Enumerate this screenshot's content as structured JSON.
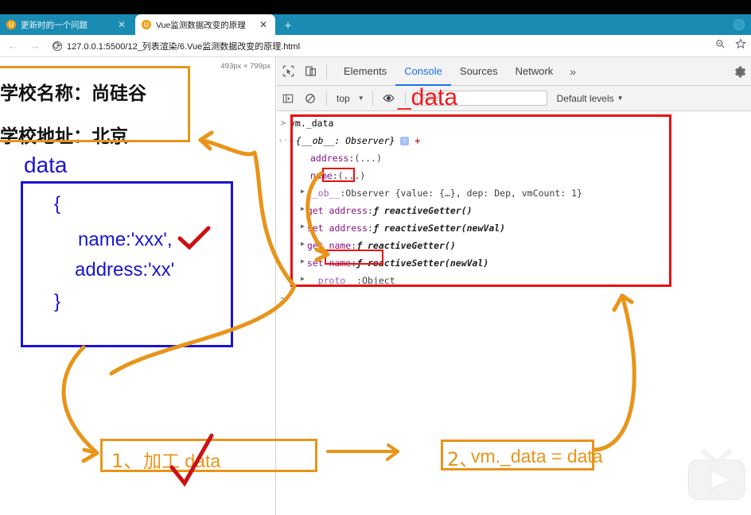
{
  "browser": {
    "tabs": [
      {
        "title": "更新时的一个问题",
        "active": false,
        "close": "✕"
      },
      {
        "title": "Vue监测数据改变的原理",
        "active": true,
        "close": "✕"
      }
    ],
    "new_tab_label": "+",
    "back_label": "←",
    "forward_label": "→",
    "reload_label": "⟳",
    "info_label": "i",
    "url": "127.0.0.1:5500/12_列表渲染/6.Vue监测数据改变的原理.html",
    "zoom_icon_label": "search-zoom",
    "bookmark_icon_label": "star",
    "tabbar_color": "#1a8bb3"
  },
  "page": {
    "viewport_size": "493px × 799px",
    "lines": [
      "学校名称：尚硅谷",
      "学校地址：北京"
    ]
  },
  "devtools": {
    "inspect_icon": "cursor-select-icon",
    "device_icon": "device-toolbar-icon",
    "tabs": [
      {
        "label": "Elements",
        "active": false
      },
      {
        "label": "Console",
        "active": true
      },
      {
        "label": "Sources",
        "active": false
      },
      {
        "label": "Network",
        "active": false
      }
    ],
    "more_tabs": "»",
    "settings_icon": "gear-icon",
    "console_toolbar": {
      "sidebar_toggle": "console-sidebar-icon",
      "clear_label": "clear-console-icon",
      "context": "top",
      "context_caret": "▼",
      "eye_icon": "live-expression-eye-icon",
      "filter_placeholder": "Filter",
      "levels": "Default levels",
      "levels_caret": "▼"
    },
    "console": {
      "input_prompt": ">",
      "input_expression": "vm._data",
      "result_prompt": "‹·",
      "result_header": {
        "triangle": "▼",
        "text": "{__ob__: Observer}",
        "info_badge": "i",
        "plus": "+"
      },
      "rows": [
        {
          "triangle": "",
          "key": "address",
          "sep": ": ",
          "value": "(...)"
        },
        {
          "triangle": "",
          "key": "name",
          "sep": ": ",
          "value": "(...)"
        },
        {
          "triangle": "▶",
          "key": "__ob__",
          "sep": ": ",
          "value": "Observer {value: {…}, dep: Dep, vmCount: 1}"
        },
        {
          "triangle": "▶",
          "key": "get address",
          "sep": ": ",
          "value": "ƒ reactiveGetter()"
        },
        {
          "triangle": "▶",
          "key": "set address",
          "sep": ": ",
          "value": "ƒ reactiveSetter(newVal)"
        },
        {
          "triangle": "▶",
          "key": "get name",
          "sep": ": ",
          "value": "ƒ reactiveGetter()"
        },
        {
          "triangle": "▶",
          "key": "set name",
          "sep": ": ",
          "value": "ƒ reactiveSetter(newVal)"
        },
        {
          "triangle": "▶",
          "key": "__proto__",
          "sep": ": ",
          "value": "Object"
        }
      ],
      "bottom_prompt": ">"
    }
  },
  "annotations": {
    "data_label_blue": "data",
    "data_code": {
      "open_brace": "{",
      "line1": "name:'xxx',",
      "line2": "address:'xx'",
      "close_brace": "}"
    },
    "red_data_overlay": "_data",
    "step1_number": "1、",
    "step1_text": "加工 data",
    "step2_number": "2、",
    "step2_text": "vm._data = data",
    "highlight_name": "name",
    "highlight_set_name": "set name",
    "colors": {
      "orange": "#e8941a",
      "red": "#e8100f",
      "blue": "#1a14d0",
      "red_text": "#ef1b1b",
      "check_red": "#cc1111"
    }
  }
}
